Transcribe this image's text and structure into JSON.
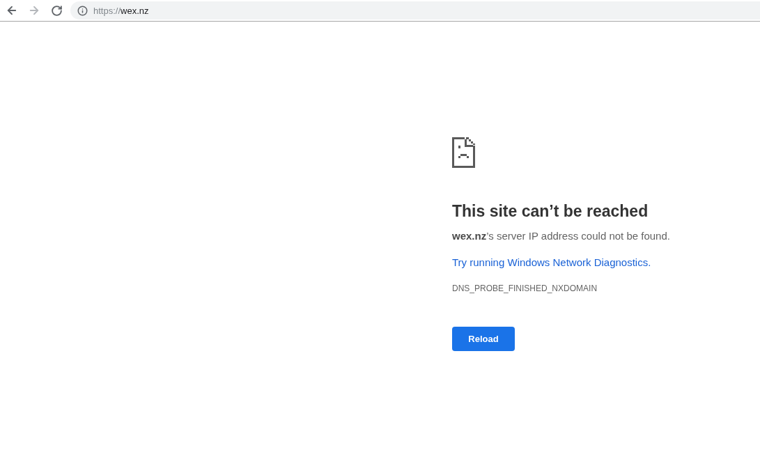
{
  "toolbar": {
    "buttons": [
      {
        "kind": "back",
        "disabled": false
      },
      {
        "kind": "forward",
        "disabled": true
      },
      {
        "kind": "reload",
        "disabled": false
      }
    ],
    "omnibox": {
      "scheme": "https://",
      "host": "wex.nz"
    }
  },
  "error": {
    "title": "This site can’t be reached",
    "message": "**wex.nz**’s server IP address could not be found.",
    "suggestion": "Try running Windows Network Diagnostics.",
    "code": "DNS_PROBE_FINISHED_NXDOMAIN",
    "button": "Reload"
  }
}
